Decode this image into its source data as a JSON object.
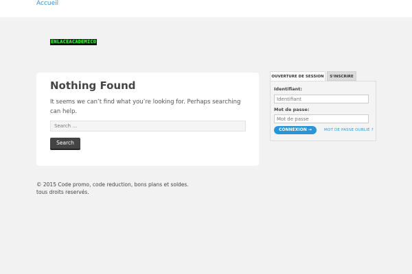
{
  "nav": {
    "home_label": "Accueil"
  },
  "logo": {
    "text": "ENLACEACADEMICO"
  },
  "main": {
    "title": "Nothing Found",
    "message": "It seems we can’t find what you’re looking for. Perhaps searching can help.",
    "search_placeholder": "Search …",
    "search_button": "Search"
  },
  "footer": {
    "copyright": "© 2015 Code promo, code reduction, bons plans et soldes. tous droits reservés."
  },
  "login": {
    "tab_login": "OUVERTURE DE SESSION",
    "tab_register": "S'INSCRIRE",
    "username_label": "Identifiant:",
    "username_placeholder": "Identifiant",
    "password_label": "Mot de passe:",
    "password_placeholder": "Mot de passe",
    "submit_button": "CONNEXION →",
    "forgot_link": "MOT DE PASSE OUBLIÉ ?"
  },
  "colors": {
    "accent": "#2a95d6",
    "background": "#f2f2f2",
    "logo_green": "#2bd62b"
  }
}
